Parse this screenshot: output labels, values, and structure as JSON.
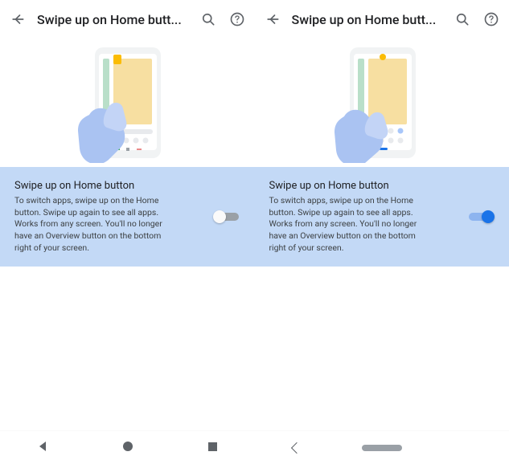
{
  "left": {
    "header": {
      "title": "Swipe up on Home butt..."
    },
    "setting": {
      "title": "Swipe up on Home button",
      "description": "To switch apps, swipe up on the Home button. Swipe up again to see all apps. Works from any screen. You'll no longer have an Overview button on the bottom right of your screen.",
      "enabled": false
    }
  },
  "right": {
    "header": {
      "title": "Swipe up on Home butt..."
    },
    "setting": {
      "title": "Swipe up on Home button",
      "description": "To switch apps, swipe up on the Home button. Swipe up again to see all apps. Works from any screen. You'll no longer have an Overview button on the bottom right of your screen.",
      "enabled": true
    }
  }
}
